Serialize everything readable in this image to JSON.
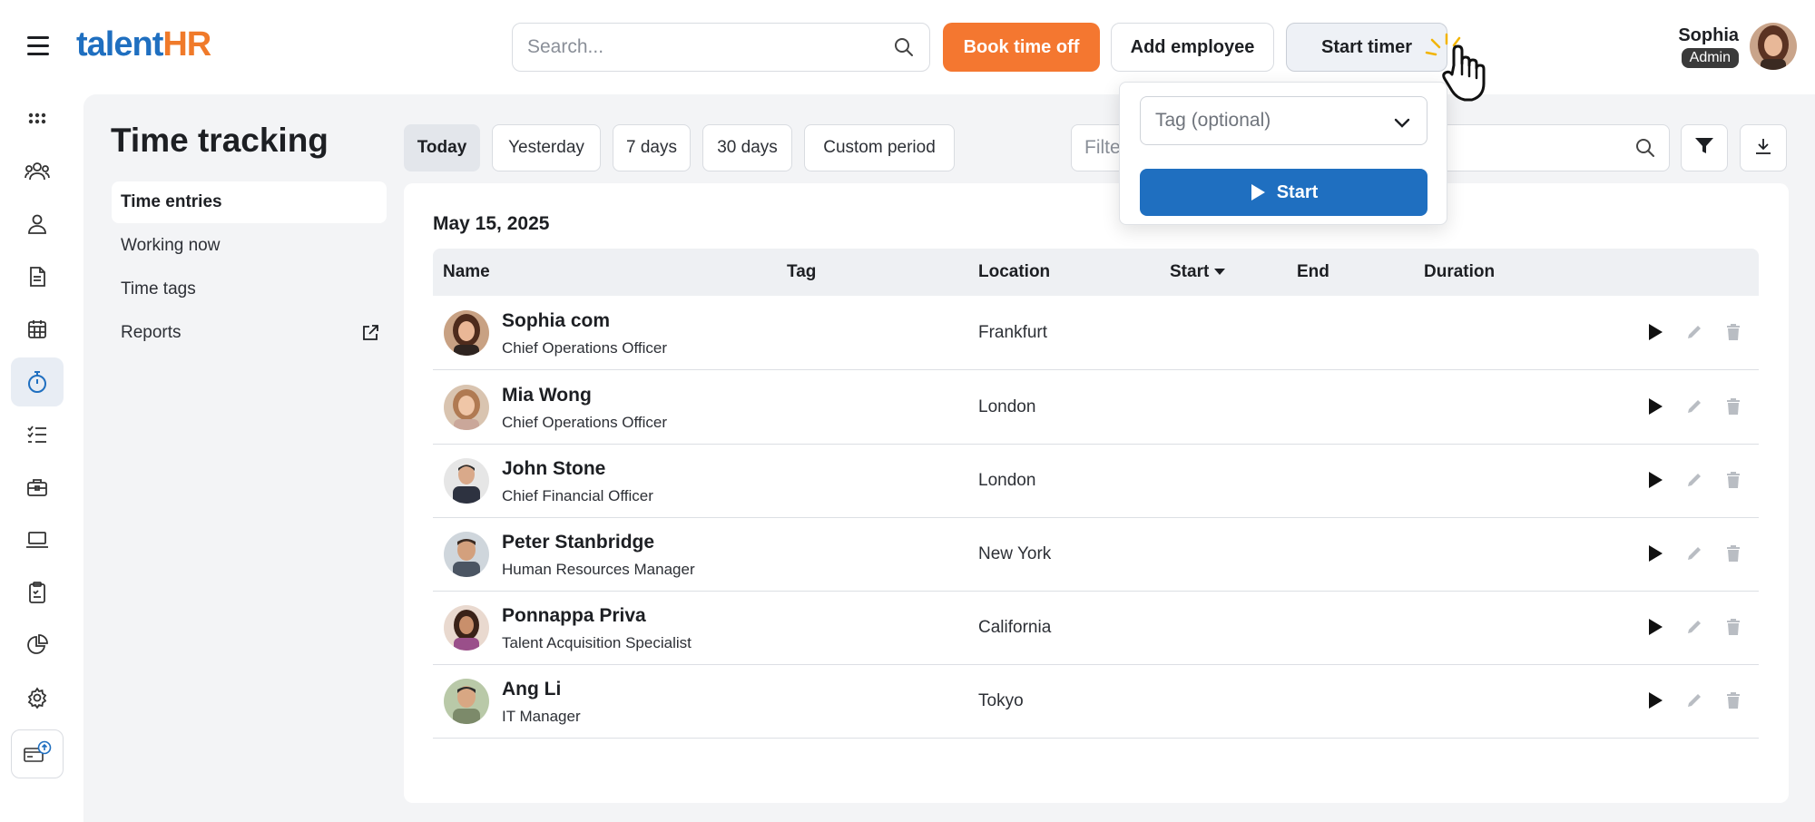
{
  "header": {
    "logo_talent": "talent",
    "logo_hr": "HR",
    "search_placeholder": "Search...",
    "book_time_off": "Book time off",
    "add_employee": "Add employee",
    "start_timer": "Start timer",
    "user_name": "Sophia",
    "user_role": "Admin"
  },
  "page": {
    "title": "Time tracking"
  },
  "subnav": {
    "items": [
      {
        "label": "Time entries"
      },
      {
        "label": "Working now"
      },
      {
        "label": "Time tags"
      },
      {
        "label": "Reports"
      }
    ]
  },
  "ranges": [
    "Today",
    "Yesterday",
    "7 days",
    "30 days",
    "Custom period"
  ],
  "filter_placeholder": "Filter",
  "table": {
    "date": "May 15, 2025",
    "columns": {
      "name": "Name",
      "tag": "Tag",
      "location": "Location",
      "start": "Start",
      "end": "End",
      "duration": "Duration"
    },
    "rows": [
      {
        "name": "Sophia com",
        "role": "Chief Operations Officer",
        "location": "Frankfurt"
      },
      {
        "name": "Mia Wong",
        "role": "Chief Operations Officer",
        "location": "London"
      },
      {
        "name": "John Stone",
        "role": "Chief Financial Officer",
        "location": "London"
      },
      {
        "name": "Peter Stanbridge",
        "role": "Human Resources Manager",
        "location": "New York"
      },
      {
        "name": "Ponnappa Priva",
        "role": "Talent Acquisition Specialist",
        "location": "California"
      },
      {
        "name": "Ang Li",
        "role": "IT Manager",
        "location": "Tokyo"
      }
    ]
  },
  "popover": {
    "tag_placeholder": "Tag (optional)",
    "start_label": "Start"
  },
  "colors": {
    "brand_blue": "#1f6fc0",
    "brand_orange": "#f47730"
  },
  "icons": [
    "menu-icon",
    "search-icon",
    "dashboard-icon",
    "team-icon",
    "person-icon",
    "document-icon",
    "calendar-icon",
    "stopwatch-icon",
    "checklist-icon",
    "briefcase-icon",
    "laptop-icon",
    "clipboard-icon",
    "pie-chart-icon",
    "gear-icon",
    "billing-upgrade-icon",
    "external-link-icon",
    "filter-icon",
    "download-icon",
    "play-icon",
    "pencil-icon",
    "trash-icon",
    "chevron-down-icon",
    "pointer-hand-icon"
  ]
}
